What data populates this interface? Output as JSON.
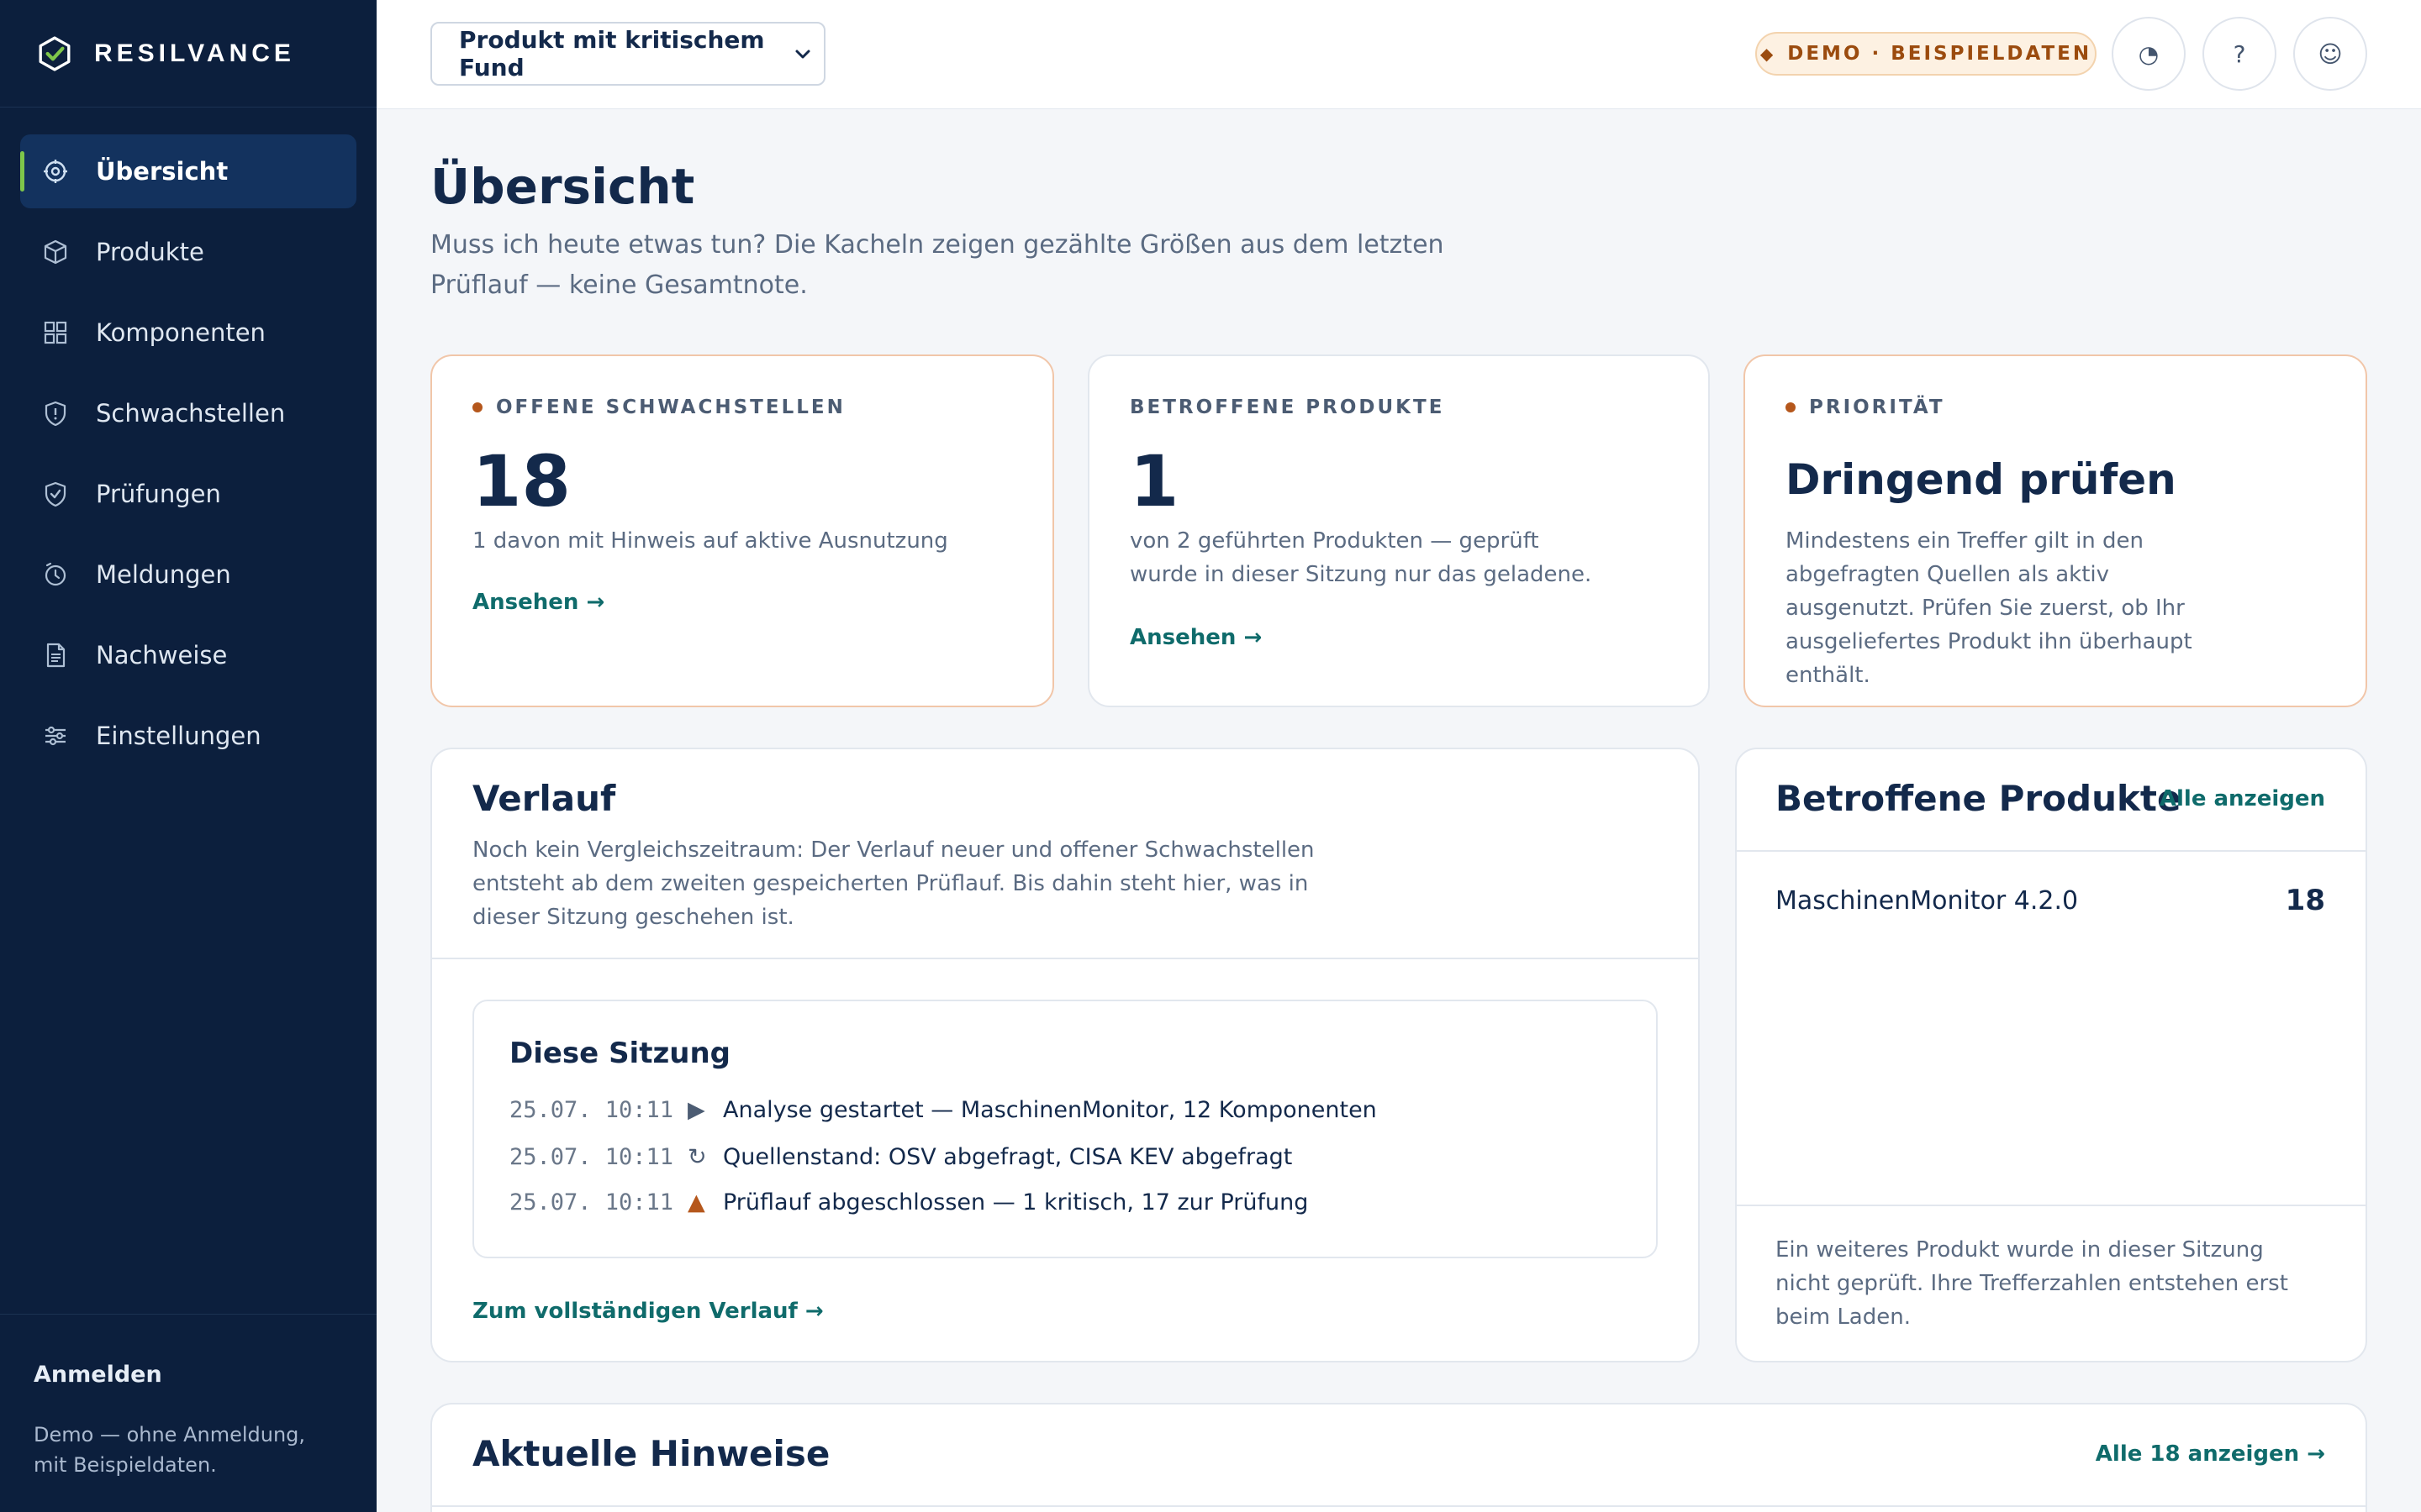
{
  "app": {
    "brand": "RESILVANCE"
  },
  "sidebar": {
    "items": [
      {
        "label": "Übersicht",
        "icon": "overview-icon",
        "active": true
      },
      {
        "label": "Produkte",
        "icon": "box-icon"
      },
      {
        "label": "Komponenten",
        "icon": "grid-icon"
      },
      {
        "label": "Schwachstellen",
        "icon": "shield-alert-icon"
      },
      {
        "label": "Prüfungen",
        "icon": "shield-check-icon"
      },
      {
        "label": "Meldungen",
        "icon": "clock-icon"
      },
      {
        "label": "Nachweise",
        "icon": "document-icon"
      },
      {
        "label": "Einstellungen",
        "icon": "sliders-icon"
      }
    ],
    "footer": {
      "login": "Anmelden",
      "note": "Demo — ohne Anmeldung, mit Beispieldaten."
    }
  },
  "topbar": {
    "product_select": {
      "value": "Produkt mit kritischem Fund"
    },
    "demo_badge": "DEMO · BEISPIELDATEN",
    "buttons": [
      {
        "glyph": "◔",
        "icon": "theme-icon"
      },
      {
        "glyph": "?",
        "icon": "help-icon"
      },
      {
        "glyph": "☺",
        "icon": "user-icon"
      }
    ]
  },
  "page": {
    "title": "Übersicht",
    "subtitle": "Muss ich heute etwas tun? Die Kacheln zeigen gezählte Größen aus dem letzten Prüflauf — keine Gesamtnote."
  },
  "kpis": {
    "open": {
      "label": "OFFENE SCHWACHSTELLEN",
      "value": "18",
      "desc": "1 davon mit Hinweis auf aktive Ausnutzung",
      "link": "Ansehen →"
    },
    "affected": {
      "label": "BETROFFENE PRODUKTE",
      "value": "1",
      "desc": "von 2 geführten Produkten — geprüft wurde in dieser Sitzung nur das geladene.",
      "link": "Ansehen →"
    },
    "priority": {
      "label": "PRIORITÄT",
      "title": "Dringend prüfen",
      "desc": "Mindestens ein Treffer gilt in den abgefragten Quellen als aktiv ausgenutzt. Prüfen Sie zuerst, ob Ihr ausgeliefertes Produkt ihn überhaupt enthält."
    }
  },
  "history": {
    "title": "Verlauf",
    "text": "Noch kein Vergleichszeitraum: Der Verlauf neuer und offener Schwachstellen entsteht ab dem zweiten gespeicherten Prüflauf. Bis dahin steht hier, was in dieser Sitzung geschehen ist.",
    "session_title": "Diese Sitzung",
    "entries": [
      {
        "time": "25.07. 10:11",
        "glyph": "▶",
        "text": "Analyse gestartet — MaschinenMonitor, 12 Komponenten"
      },
      {
        "time": "25.07. 10:11",
        "glyph": "↻",
        "text": "Quellenstand: OSV abgefragt, CISA KEV abgefragt"
      },
      {
        "time": "25.07. 10:11",
        "glyph": "▲",
        "text": "Prüflauf abgeschlossen — 1 kritisch, 17 zur Prüfung"
      }
    ],
    "link": "Zum vollständigen Verlauf →"
  },
  "affected_products": {
    "title": "Betroffene Produkte",
    "link": "Alle anzeigen",
    "rows": [
      {
        "name": "MaschinenMonitor 4.2.0",
        "count": "18"
      }
    ],
    "note": "Ein weiteres Produkt wurde in dieser Sitzung nicht geprüft. Ihre Trefferzahlen entstehen erst beim Laden."
  },
  "notices": {
    "title": "Aktuelle Hinweise",
    "link": "Alle 18 anzeigen →"
  }
}
